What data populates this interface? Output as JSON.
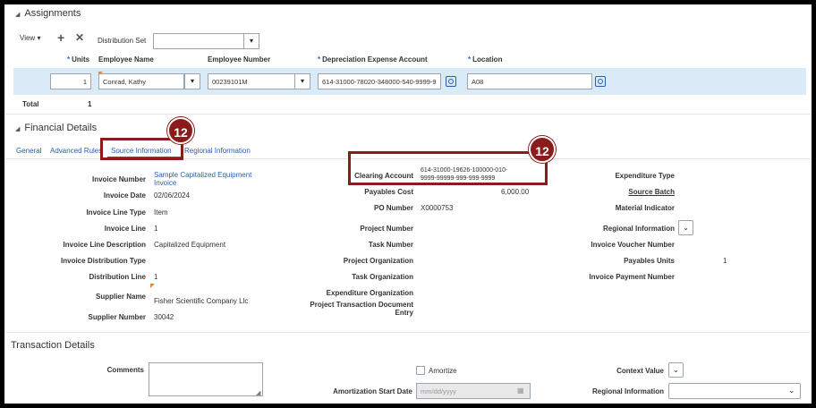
{
  "assignments": {
    "title": "Assignments",
    "toolbar": {
      "view_label": "View",
      "distribution_set_label": "Distribution Set",
      "distribution_set_value": ""
    },
    "columns": {
      "units": "Units",
      "employee_name": "Employee Name",
      "employee_number": "Employee Number",
      "dep_expense_account": "Depreciation Expense Account",
      "location": "Location"
    },
    "row": {
      "units": "1",
      "employee_name": "Conrad, Kathy",
      "employee_number": "00239101M",
      "dep_expense_account": "614-31000-78020-348000-540-9999-9",
      "location": "A08"
    },
    "total_label": "Total",
    "total_value": "1"
  },
  "financial_details": {
    "title": "Financial Details",
    "tabs": [
      "General",
      "Advanced Rules",
      "Source Information",
      "Regional Information"
    ],
    "active_tab": "Source Information",
    "col1": {
      "invoice_number_label": "Invoice Number",
      "invoice_number": "Sample Capitalized Equipment Invoice",
      "invoice_date_label": "Invoice Date",
      "invoice_date": "02/06/2024",
      "invoice_line_type_label": "Invoice Line Type",
      "invoice_line_type": "Item",
      "invoice_line_label": "Invoice Line",
      "invoice_line": "1",
      "invoice_line_desc_label": "Invoice Line Description",
      "invoice_line_desc": "Capitalized Equipment",
      "invoice_dist_type_label": "Invoice Distribution Type",
      "distribution_line_label": "Distribution Line",
      "distribution_line": "1",
      "supplier_name_label": "Supplier Name",
      "supplier_name": "Fisher Scientific Company Llc",
      "supplier_number_label": "Supplier Number",
      "supplier_number": "30042"
    },
    "col2": {
      "clearing_account_label": "Clearing Account",
      "clearing_account_1": "614-31000-19626-100000-010-",
      "clearing_account_2": "9999-99999-999-999-9999",
      "payables_cost_label": "Payables Cost",
      "payables_cost": "6,000.00",
      "po_number_label": "PO Number",
      "po_number": "X0000753",
      "project_number_label": "Project Number",
      "task_number_label": "Task Number",
      "project_org_label": "Project Organization",
      "task_org_label": "Task Organization",
      "expenditure_org_label": "Expenditure Organization",
      "project_txn_doc_label_1": "Project Transaction Document",
      "project_txn_doc_label_2": "Entry"
    },
    "col3": {
      "expenditure_type_label": "Expenditure Type",
      "source_batch_label": "Source Batch",
      "material_indicator_label": "Material Indicator",
      "regional_info_label": "Regional Information",
      "invoice_voucher_label": "Invoice Voucher Number",
      "payables_units_label": "Payables Units",
      "payables_units": "1",
      "invoice_payment_label": "Invoice Payment Number"
    }
  },
  "transaction_details": {
    "title": "Transaction Details",
    "comments_label": "Comments",
    "amortize_label": "Amortize",
    "amortization_start_label": "Amortization Start Date",
    "amortization_start_placeholder": "mm/dd/yyyy",
    "context_value_label": "Context Value",
    "regional_info_label": "Regional Information"
  },
  "callouts": {
    "badge_1": "12",
    "badge_2": "12"
  },
  "colors": {
    "callout": "#8a1c1c",
    "link": "#2a5db0",
    "row_highlight": "#dbeaf7"
  }
}
